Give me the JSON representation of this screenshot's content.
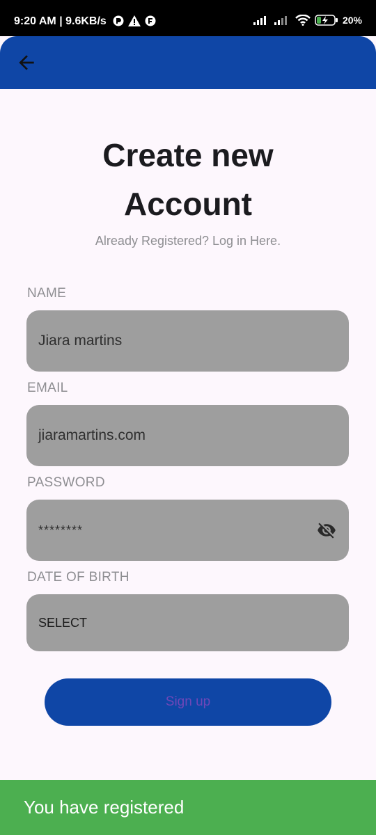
{
  "status_bar": {
    "time_and_speed": "9:20 AM | 9.6KB/s",
    "battery": "20%"
  },
  "title_line1": "Create new",
  "title_line2": "Account",
  "subtitle": "Already Registered? Log in Here.",
  "fields": {
    "name": {
      "label": "NAME",
      "value": "Jiara martins"
    },
    "email": {
      "label": "EMAIL",
      "value": "jiaramartins.com"
    },
    "password": {
      "label": "PASSWORD",
      "value": "********"
    },
    "dob": {
      "label": "DATE OF BIRTH",
      "value": "SELECT"
    }
  },
  "signup_label": "Sign up",
  "snackbar": "You have registered",
  "colors": {
    "primary": "#0f46a6",
    "field_bg": "#9e9e9e",
    "success": "#4caf50",
    "button_text": "#6f47b8"
  }
}
